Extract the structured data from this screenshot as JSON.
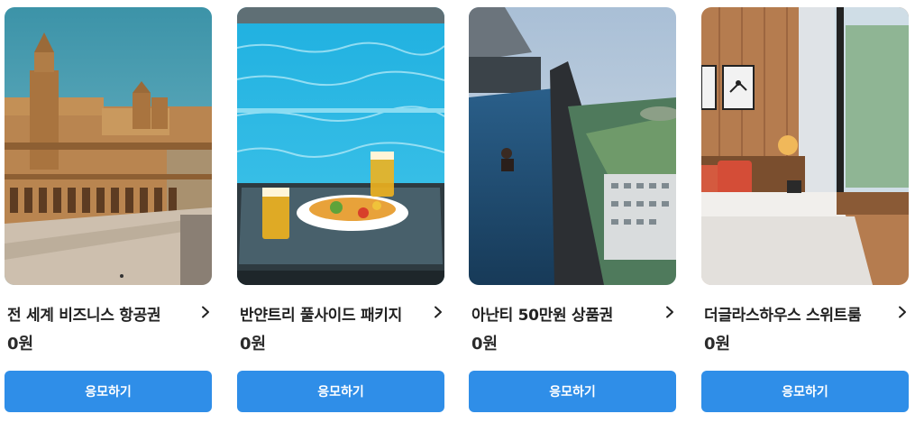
{
  "products": [
    {
      "title": "전 세계 비즈니스 항공권",
      "price": "0원",
      "button_label": "응모하기",
      "image": "seville-plaza-photo"
    },
    {
      "title": "반얀트리 풀사이드 패키지",
      "price": "0원",
      "button_label": "응모하기",
      "image": "poolside-meal-photo"
    },
    {
      "title": "아난티 50만원 상품권",
      "price": "0원",
      "button_label": "응모하기",
      "image": "infinity-pool-photo"
    },
    {
      "title": "더글라스하우스 스위트룸",
      "price": "0원",
      "button_label": "응모하기",
      "image": "suite-bedroom-photo"
    }
  ],
  "icons": {
    "detail": "chevron-right-icon"
  },
  "colors": {
    "button": "#2f8ee8",
    "button_text": "#ffffff",
    "title_text": "#222222"
  }
}
